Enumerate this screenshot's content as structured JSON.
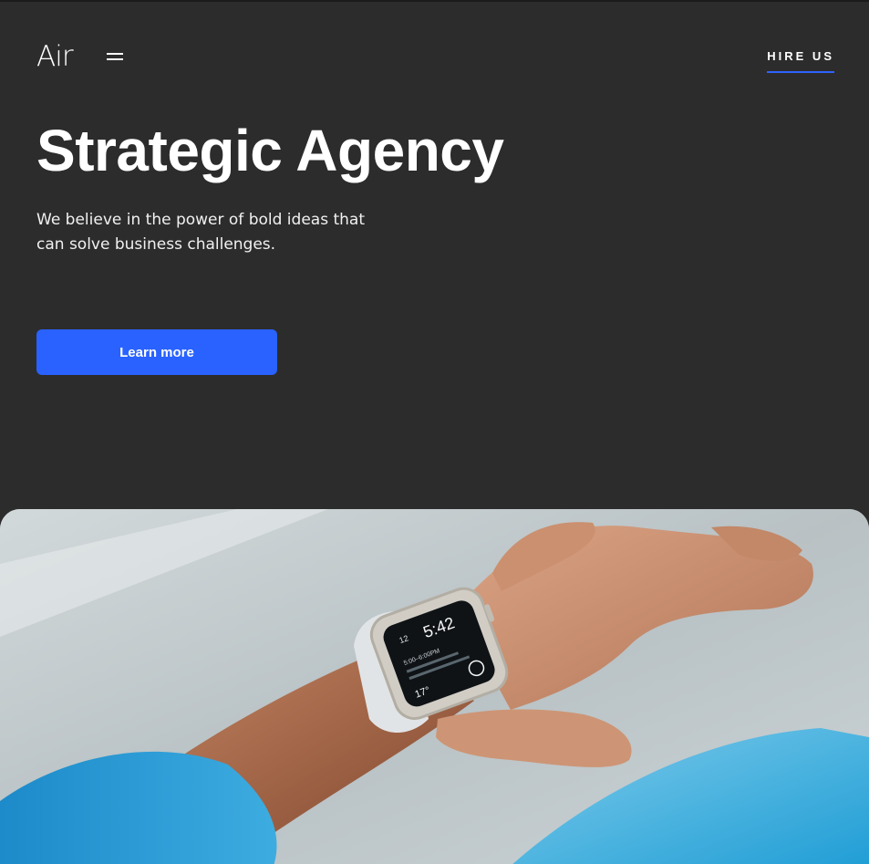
{
  "header": {
    "logo": "Air",
    "menu_icon": "hamburger-icon",
    "hire_label": "HIRE US"
  },
  "hero": {
    "title": "Strategic Agency",
    "subtitle": "We believe in the power of bold ideas that can solve business challenges.",
    "cta_label": "Learn more"
  },
  "watch": {
    "date": "12",
    "time": "5:42",
    "event_time": "5:00–6:00PM",
    "temperature": "17°"
  },
  "colors": {
    "background": "#2c2c2c",
    "accent": "#2962ff",
    "text": "#ffffff"
  }
}
